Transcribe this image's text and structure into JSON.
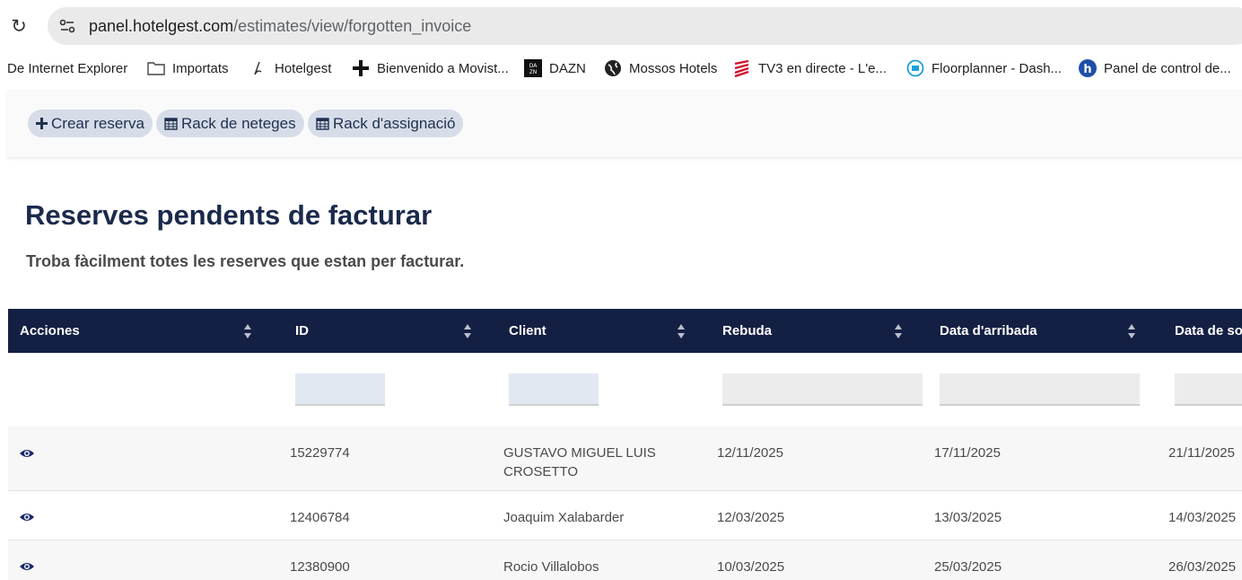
{
  "browser": {
    "url_host": "panel.hotelgest.com",
    "url_path": "/estimates/view/forgotten_invoice",
    "bookmarks": [
      {
        "label": "De Internet Explorer",
        "icon": "none"
      },
      {
        "label": "Importats",
        "icon": "folder-icon"
      },
      {
        "label": "Hotelgest",
        "icon": "hotelgest-icon"
      },
      {
        "label": "Bienvenido a Movist...",
        "icon": "plus-icon"
      },
      {
        "label": "DAZN",
        "icon": "dazn-icon"
      },
      {
        "label": "Mossos Hotels",
        "icon": "globe-icon"
      },
      {
        "label": "TV3 en directe - L'e...",
        "icon": "tv3-icon"
      },
      {
        "label": "Floorplanner - Dash...",
        "icon": "floorplanner-icon"
      },
      {
        "label": "Panel de control de...",
        "icon": "h-icon"
      }
    ]
  },
  "toolbar": {
    "buttons": [
      {
        "label": "Crear reserva",
        "icon": "plus-icon"
      },
      {
        "label": "Rack de neteges",
        "icon": "calendar-icon"
      },
      {
        "label": "Rack d'assignació",
        "icon": "calendar-icon"
      }
    ]
  },
  "page": {
    "title": "Reserves pendents de facturar",
    "subtitle": "Troba fàcilment totes les reserves que estan per facturar."
  },
  "table": {
    "headers": [
      "Acciones",
      "ID",
      "Client",
      "Rebuda",
      "Data d'arribada",
      "Data de so"
    ],
    "rows": [
      {
        "id": "15229774",
        "client": "GUSTAVO MIGUEL LUIS CROSETTO",
        "rebuda": "12/11/2025",
        "arribada": "17/11/2025",
        "sortida": "21/11/2025"
      },
      {
        "id": "12406784",
        "client": "Joaquim Xalabarder",
        "rebuda": "12/03/2025",
        "arribada": "13/03/2025",
        "sortida": "14/03/2025"
      },
      {
        "id": "12380900",
        "client": "Rocio Villalobos",
        "rebuda": "10/03/2025",
        "arribada": "25/03/2025",
        "sortida": "26/03/2025"
      }
    ]
  },
  "colors": {
    "header_bg": "#142043",
    "pill_bg": "#d6dde9",
    "title": "#1b2a4c"
  }
}
